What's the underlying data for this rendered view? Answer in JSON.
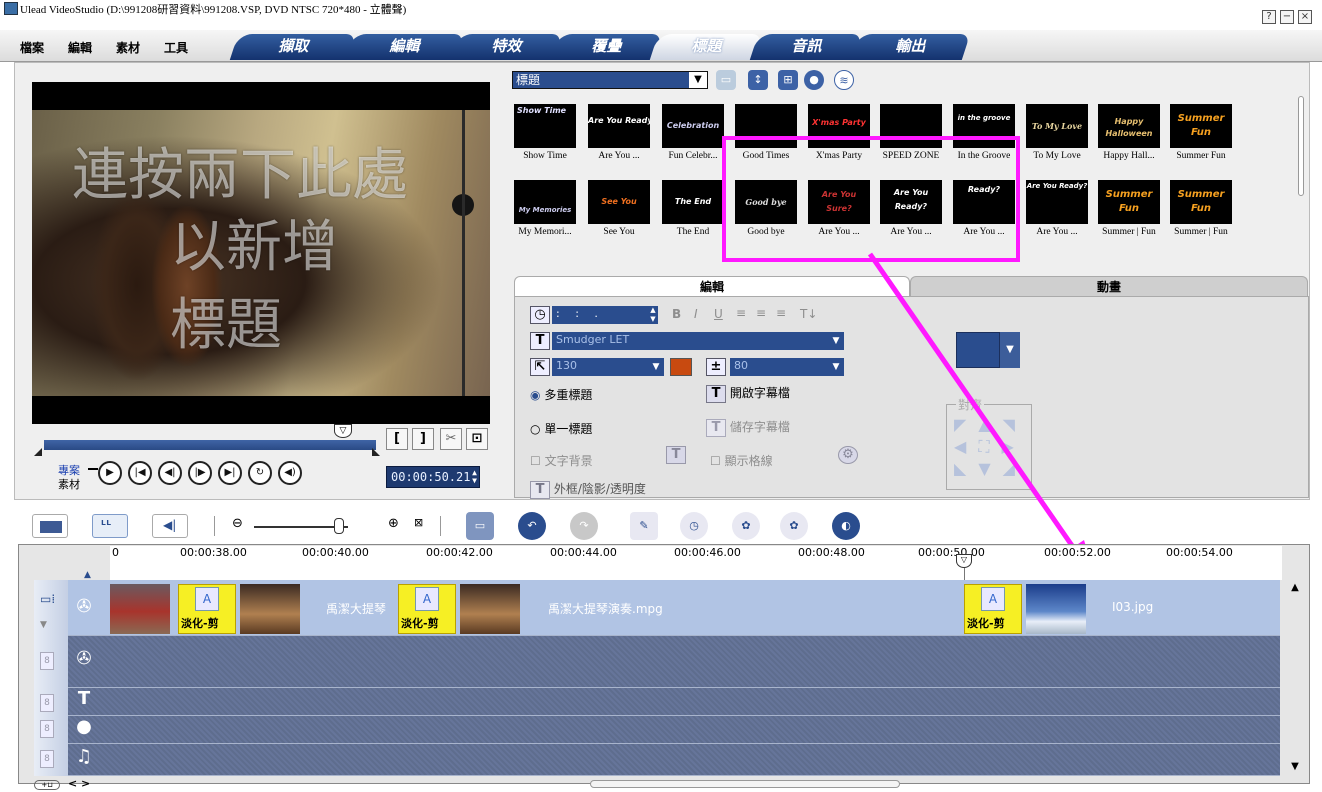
{
  "window": {
    "title": "Ulead VideoStudio (D:\\991208研習資料\\991208.VSP, DVD NTSC 720*480 - 立體聲)",
    "buttons": [
      "?",
      "−",
      "×"
    ]
  },
  "menu": [
    "檔案",
    "編輯",
    "素材",
    "工具"
  ],
  "steps": [
    "擷取",
    "編輯",
    "特效",
    "覆疊",
    "標題",
    "音訊",
    "輸出"
  ],
  "active_step": "標題",
  "preview": {
    "overlay_lines": [
      "連按兩下此處",
      "以新增",
      "標題"
    ],
    "project_label": "專案",
    "clip_label": "素材",
    "timecode": "00:00:50.21",
    "trim_buttons": [
      "[",
      "]",
      "✂",
      "⊡"
    ]
  },
  "library": {
    "category": "標題",
    "row1": [
      {
        "label": "Show Time",
        "art": "Show Time"
      },
      {
        "label": "Are You ...",
        "art": "Are You Ready?"
      },
      {
        "label": "Fun Celebr...",
        "art": "Celebration"
      },
      {
        "label": "Good Times",
        "art": ""
      },
      {
        "label": "X'mas Party",
        "art": "X'mas Party"
      },
      {
        "label": "SPEED ZONE",
        "art": ""
      },
      {
        "label": "In the Groove",
        "art": "in the groove"
      },
      {
        "label": "To My Love",
        "art": "To My Love"
      },
      {
        "label": "Happy Hall...",
        "art": "Happy Halloween"
      },
      {
        "label": "Summer Fun",
        "art": "Summer Fun"
      }
    ],
    "row2": [
      {
        "label": "My Memori...",
        "art": "My Memories"
      },
      {
        "label": "See You",
        "art": "See You"
      },
      {
        "label": "The End",
        "art": "The End"
      },
      {
        "label": "Good bye",
        "art": "Good bye"
      },
      {
        "label": "Are You ...",
        "art": "Are You Sure?"
      },
      {
        "label": "Are You ...",
        "art": "Are You Ready?"
      },
      {
        "label": "Are You ...",
        "art": "Ready?"
      },
      {
        "label": "Are You ...",
        "art": "Are You Ready?"
      },
      {
        "label": "Summer | Fun",
        "art": "Summer Fun"
      },
      {
        "label": "Summer | Fun",
        "art": "Summer Fun"
      }
    ]
  },
  "edit_panel": {
    "tab_edit": "編輯",
    "tab_animation": "動畫",
    "duration": ": : .",
    "font": "Smudger LET",
    "size": "130",
    "line_spacing": "80",
    "multi_title": "多重標題",
    "single_title": "單一標題",
    "text_background": "文字背景",
    "show_grid": "顯示格線",
    "open_subtitle": "開啟字幕檔",
    "save_subtitle": "儲存字幕檔",
    "border_shadow": "外框/陰影/透明度",
    "align_label": "對齊",
    "text_color": "#c84a10"
  },
  "timeline": {
    "ruler": [
      "0",
      "00:00:38.00",
      "00:00:40.00",
      "00:00:42.00",
      "00:00:44.00",
      "00:00:46.00",
      "00:00:48.00",
      "00:00:50.00",
      "00:00:52.00",
      "00:00:54.00"
    ],
    "clip_name_1": "禹潔大提琴",
    "clip_name_2": "禹潔大提琴演奏.mpg",
    "clip_name_3": "I03.jpg",
    "transition_label": "淡化-剪",
    "nav": "< >"
  }
}
